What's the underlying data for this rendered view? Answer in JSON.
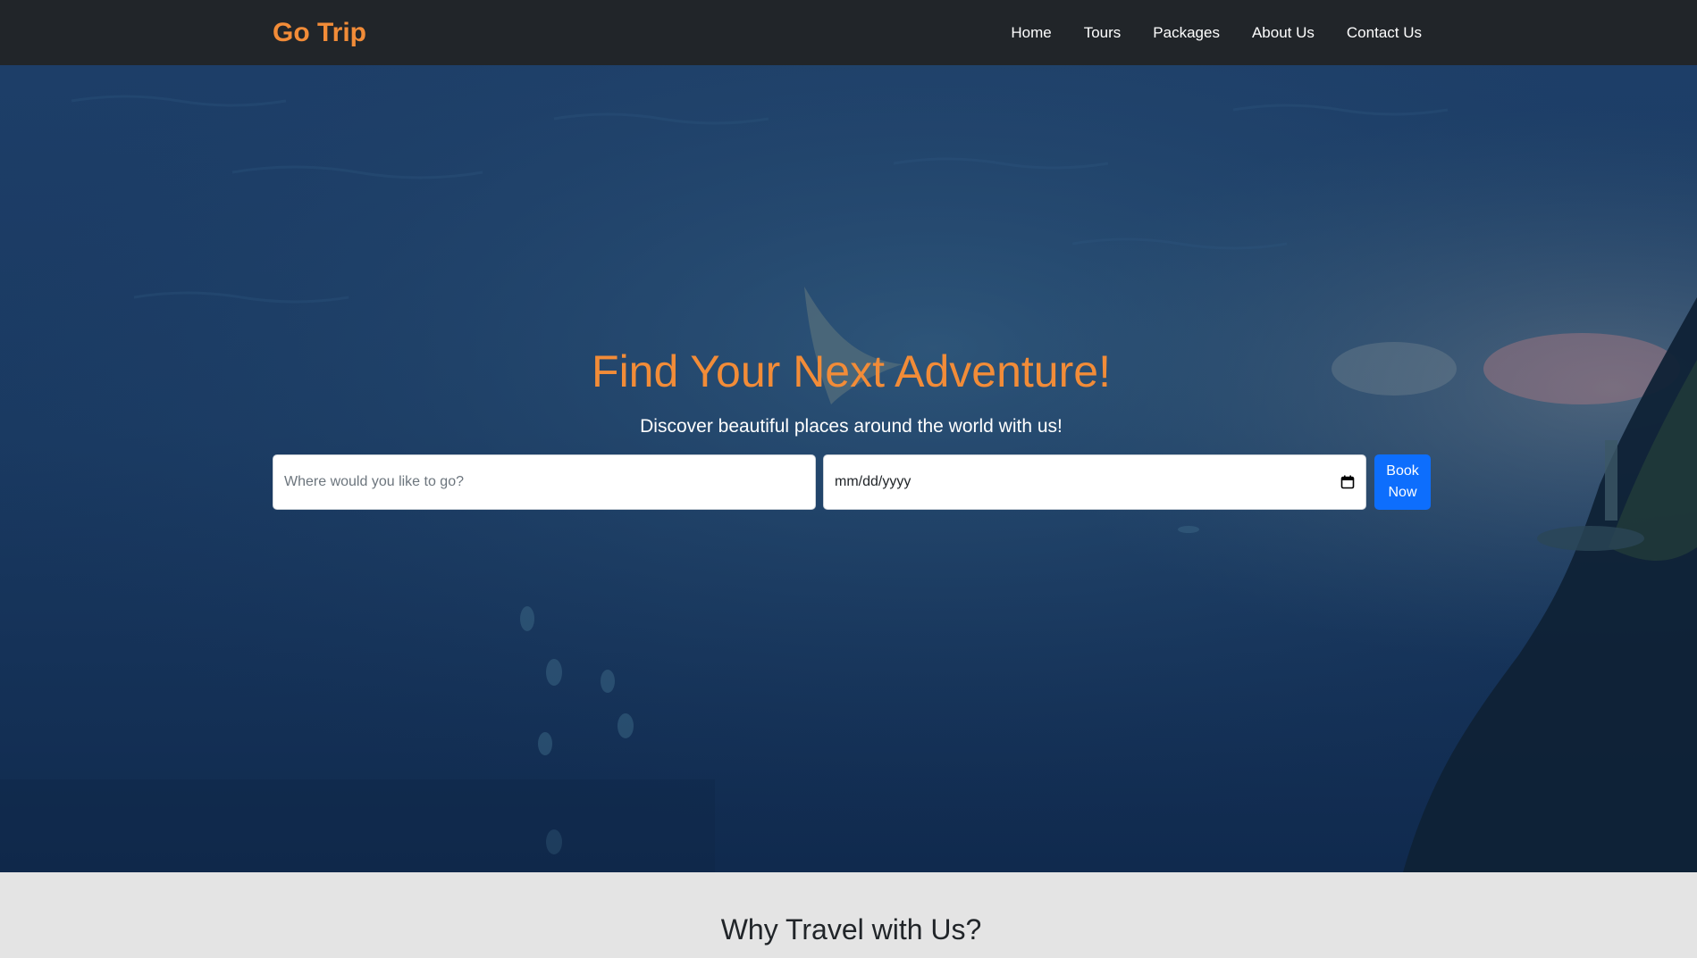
{
  "navbar": {
    "brand": "Go Trip",
    "links": [
      {
        "label": "Home"
      },
      {
        "label": "Tours"
      },
      {
        "label": "Packages"
      },
      {
        "label": "About Us"
      },
      {
        "label": "Contact Us"
      }
    ]
  },
  "hero": {
    "title": "Find Your Next Adventure!",
    "subtitle": "Discover beautiful places around the world with us!",
    "destination_placeholder": "Where would you like to go?",
    "destination_value": "",
    "date_placeholder": "mm/dd/yyyy",
    "book_button": "Book Now",
    "background_image": "underwater-manta-ray-scene"
  },
  "section": {
    "title": "Why Travel with Us?"
  },
  "colors": {
    "navbar_bg": "#212529",
    "accent_orange": "#f28c38",
    "primary_blue": "#0d6efd",
    "section_bg": "#e4e4e4"
  }
}
